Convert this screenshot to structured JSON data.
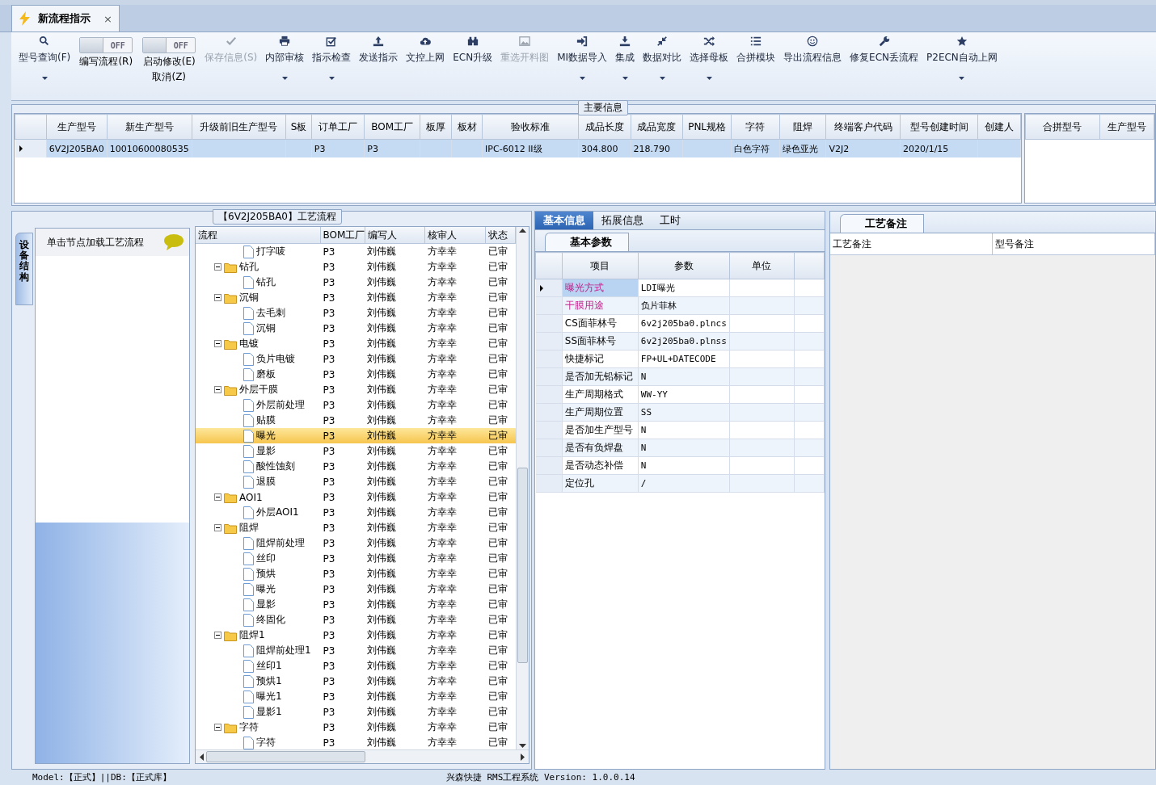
{
  "document_tab": {
    "title": "新流程指示",
    "close": "×"
  },
  "toolbar": [
    {
      "kind": "button",
      "label": "型号查询(F)",
      "dropdown": true,
      "disabled": false
    },
    {
      "kind": "toggle",
      "toggle_text": "OFF",
      "on": false,
      "label": "编写流程(R)"
    },
    {
      "kind": "toggle",
      "toggle_text": "OFF",
      "on": false,
      "label": "启动修改(E)",
      "label2": "取消(Z)"
    },
    {
      "kind": "button",
      "label": "保存信息(S)",
      "dropdown": false,
      "disabled": true
    },
    {
      "kind": "button",
      "label": "内部审核",
      "dropdown": true,
      "disabled": false
    },
    {
      "kind": "button",
      "label": "指示检查",
      "dropdown": true,
      "disabled": false
    },
    {
      "kind": "button",
      "label": "发送指示",
      "dropdown": false,
      "disabled": false
    },
    {
      "kind": "button",
      "label": "文控上网",
      "dropdown": false,
      "disabled": false
    },
    {
      "kind": "button",
      "label": "ECN升级",
      "dropdown": false,
      "disabled": false
    },
    {
      "kind": "button",
      "label": "重选开料图",
      "dropdown": false,
      "disabled": true
    },
    {
      "kind": "button",
      "label": "MI数据导入",
      "dropdown": true,
      "disabled": false
    },
    {
      "kind": "button",
      "label": "集成",
      "dropdown": true,
      "disabled": false
    },
    {
      "kind": "button",
      "label": "数据对比",
      "dropdown": true,
      "disabled": false
    },
    {
      "kind": "button",
      "label": "选择母板",
      "dropdown": true,
      "disabled": false
    },
    {
      "kind": "button",
      "label": "合拼模块",
      "dropdown": false,
      "disabled": false
    },
    {
      "kind": "button",
      "label": "导出流程信息",
      "dropdown": false,
      "disabled": false
    },
    {
      "kind": "button",
      "label": "修复ECN丢流程",
      "dropdown": false,
      "disabled": false
    },
    {
      "kind": "button",
      "label": "P2ECN自动上网",
      "dropdown": true,
      "disabled": false
    }
  ],
  "main_info": {
    "title": "主要信息",
    "columns": [
      "生产型号",
      "新生产型号",
      "升级前旧生产型号",
      "S板",
      "订单工厂",
      "BOM工厂",
      "板厚",
      "板材",
      "验收标准",
      "成品长度",
      "成品宽度",
      "PNL规格",
      "字符",
      "阻焊",
      "终端客户代码",
      "型号创建时间",
      "创建人"
    ],
    "rows": [
      {
        "selected": true,
        "cells": [
          "6V2J205BA0",
          "10010600080535",
          null,
          null,
          "P3",
          "P3",
          null,
          null,
          "IPC-6012 II级",
          "304.800",
          "218.790",
          null,
          "白色字符",
          "绿色亚光",
          "V2J2",
          "2020/1/15",
          null
        ]
      }
    ],
    "merge_columns": [
      "合拼型号",
      "生产型号"
    ]
  },
  "flow_panel": {
    "title": "【6V2J205BA0】工艺流程",
    "side_tab": "设备结构",
    "hint": "单击节点加载工艺流程",
    "columns": [
      "流程",
      "BOM工厂",
      "编写人",
      "核审人",
      "状态"
    ],
    "tree": [
      {
        "kind": "file",
        "label": "打字唛",
        "bom": "P3",
        "writer": "刘伟巍",
        "reviewer": "方幸幸",
        "status": "已审",
        "selected": false
      },
      {
        "kind": "folder",
        "label": "钻孔",
        "bom": "P3",
        "writer": "刘伟巍",
        "reviewer": "方幸幸",
        "status": "已审",
        "selected": false,
        "expanded": true,
        "children": [
          {
            "kind": "file",
            "label": "钻孔",
            "bom": "P3",
            "writer": "刘伟巍",
            "reviewer": "方幸幸",
            "status": "已审",
            "selected": false
          }
        ]
      },
      {
        "kind": "folder",
        "label": "沉铜",
        "bom": "P3",
        "writer": "刘伟巍",
        "reviewer": "方幸幸",
        "status": "已审",
        "selected": false,
        "expanded": true,
        "children": [
          {
            "kind": "file",
            "label": "去毛刺",
            "bom": "P3",
            "writer": "刘伟巍",
            "reviewer": "方幸幸",
            "status": "已审",
            "selected": false
          },
          {
            "kind": "file",
            "label": "沉铜",
            "bom": "P3",
            "writer": "刘伟巍",
            "reviewer": "方幸幸",
            "status": "已审",
            "selected": false
          }
        ]
      },
      {
        "kind": "folder",
        "label": "电镀",
        "bom": "P3",
        "writer": "刘伟巍",
        "reviewer": "方幸幸",
        "status": "已审",
        "selected": false,
        "expanded": true,
        "children": [
          {
            "kind": "file",
            "label": "负片电镀",
            "bom": "P3",
            "writer": "刘伟巍",
            "reviewer": "方幸幸",
            "status": "已审",
            "selected": false
          },
          {
            "kind": "file",
            "label": "磨板",
            "bom": "P3",
            "writer": "刘伟巍",
            "reviewer": "方幸幸",
            "status": "已审",
            "selected": false
          }
        ]
      },
      {
        "kind": "folder",
        "label": "外层干膜",
        "bom": "P3",
        "writer": "刘伟巍",
        "reviewer": "方幸幸",
        "status": "已审",
        "selected": false,
        "expanded": true,
        "children": [
          {
            "kind": "file",
            "label": "外层前处理",
            "bom": "P3",
            "writer": "刘伟巍",
            "reviewer": "方幸幸",
            "status": "已审",
            "selected": false
          },
          {
            "kind": "file",
            "label": "贴膜",
            "bom": "P3",
            "writer": "刘伟巍",
            "reviewer": "方幸幸",
            "status": "已审",
            "selected": false
          },
          {
            "kind": "file",
            "label": "曝光",
            "bom": "P3",
            "writer": "刘伟巍",
            "reviewer": "方幸幸",
            "status": "已审",
            "selected": true
          },
          {
            "kind": "file",
            "label": "显影",
            "bom": "P3",
            "writer": "刘伟巍",
            "reviewer": "方幸幸",
            "status": "已审",
            "selected": false
          },
          {
            "kind": "file",
            "label": "酸性蚀刻",
            "bom": "P3",
            "writer": "刘伟巍",
            "reviewer": "方幸幸",
            "status": "已审",
            "selected": false
          },
          {
            "kind": "file",
            "label": "退膜",
            "bom": "P3",
            "writer": "刘伟巍",
            "reviewer": "方幸幸",
            "status": "已审",
            "selected": false
          }
        ]
      },
      {
        "kind": "folder",
        "label": "AOI1",
        "bom": "P3",
        "writer": "刘伟巍",
        "reviewer": "方幸幸",
        "status": "已审",
        "selected": false,
        "expanded": true,
        "children": [
          {
            "kind": "file",
            "label": "外层AOI1",
            "bom": "P3",
            "writer": "刘伟巍",
            "reviewer": "方幸幸",
            "status": "已审",
            "selected": false
          }
        ]
      },
      {
        "kind": "folder",
        "label": "阻焊",
        "bom": "P3",
        "writer": "刘伟巍",
        "reviewer": "方幸幸",
        "status": "已审",
        "selected": false,
        "expanded": true,
        "children": [
          {
            "kind": "file",
            "label": "阻焊前处理",
            "bom": "P3",
            "writer": "刘伟巍",
            "reviewer": "方幸幸",
            "status": "已审",
            "selected": false
          },
          {
            "kind": "file",
            "label": "丝印",
            "bom": "P3",
            "writer": "刘伟巍",
            "reviewer": "方幸幸",
            "status": "已审",
            "selected": false
          },
          {
            "kind": "file",
            "label": "预烘",
            "bom": "P3",
            "writer": "刘伟巍",
            "reviewer": "方幸幸",
            "status": "已审",
            "selected": false
          },
          {
            "kind": "file",
            "label": "曝光",
            "bom": "P3",
            "writer": "刘伟巍",
            "reviewer": "方幸幸",
            "status": "已审",
            "selected": false
          },
          {
            "kind": "file",
            "label": "显影",
            "bom": "P3",
            "writer": "刘伟巍",
            "reviewer": "方幸幸",
            "status": "已审",
            "selected": false
          },
          {
            "kind": "file",
            "label": "终固化",
            "bom": "P3",
            "writer": "刘伟巍",
            "reviewer": "方幸幸",
            "status": "已审",
            "selected": false
          }
        ]
      },
      {
        "kind": "folder",
        "label": "阻焊1",
        "bom": "P3",
        "writer": "刘伟巍",
        "reviewer": "方幸幸",
        "status": "已审",
        "selected": false,
        "expanded": true,
        "children": [
          {
            "kind": "file",
            "label": "阻焊前处理1",
            "bom": "P3",
            "writer": "刘伟巍",
            "reviewer": "方幸幸",
            "status": "已审",
            "selected": false
          },
          {
            "kind": "file",
            "label": "丝印1",
            "bom": "P3",
            "writer": "刘伟巍",
            "reviewer": "方幸幸",
            "status": "已审",
            "selected": false
          },
          {
            "kind": "file",
            "label": "预烘1",
            "bom": "P3",
            "writer": "刘伟巍",
            "reviewer": "方幸幸",
            "status": "已审",
            "selected": false
          },
          {
            "kind": "file",
            "label": "曝光1",
            "bom": "P3",
            "writer": "刘伟巍",
            "reviewer": "方幸幸",
            "status": "已审",
            "selected": false
          },
          {
            "kind": "file",
            "label": "显影1",
            "bom": "P3",
            "writer": "刘伟巍",
            "reviewer": "方幸幸",
            "status": "已审",
            "selected": false
          }
        ]
      },
      {
        "kind": "folder",
        "label": "字符",
        "bom": "P3",
        "writer": "刘伟巍",
        "reviewer": "方幸幸",
        "status": "已审",
        "selected": false,
        "expanded": true,
        "children": [
          {
            "kind": "file",
            "label": "字符",
            "bom": "P3",
            "writer": "刘伟巍",
            "reviewer": "方幸幸",
            "status": "已审",
            "selected": false
          }
        ]
      }
    ]
  },
  "detail_tabs": [
    {
      "label": "基本信息",
      "selected": true
    },
    {
      "label": "拓展信息",
      "selected": false
    },
    {
      "label": "工时",
      "selected": false
    }
  ],
  "params": {
    "tab": "基本参数",
    "columns": [
      "项目",
      "参数",
      "单位"
    ],
    "rows": [
      {
        "item": "曝光方式",
        "value": "LDI曝光",
        "selected": true,
        "highlighted": true
      },
      {
        "item": "干膜用途",
        "value": "负片菲林",
        "selected": false,
        "highlighted": true
      },
      {
        "item": "CS面菲林号",
        "value": "6v2j205ba0.plncs",
        "selected": false,
        "highlighted": false
      },
      {
        "item": "SS面菲林号",
        "value": "6v2j205ba0.plnss",
        "selected": false,
        "highlighted": false
      },
      {
        "item": "快捷标记",
        "value": "FP+UL+DATECODE",
        "selected": false,
        "highlighted": false
      },
      {
        "item": "是否加无铅标记",
        "value": "N",
        "selected": false,
        "highlighted": false
      },
      {
        "item": "生产周期格式",
        "value": "WW-YY",
        "selected": false,
        "highlighted": false
      },
      {
        "item": "生产周期位置",
        "value": "SS",
        "selected": false,
        "highlighted": false
      },
      {
        "item": "是否加生产型号",
        "value": "N",
        "selected": false,
        "highlighted": false
      },
      {
        "item": "是否有负焊盘",
        "value": "N",
        "selected": false,
        "highlighted": false
      },
      {
        "item": "是否动态补偿",
        "value": "N",
        "selected": false,
        "highlighted": false
      },
      {
        "item": "定位孔",
        "value": "/",
        "selected": false,
        "highlighted": false
      }
    ]
  },
  "notes": {
    "tab": "工艺备注",
    "columns": [
      "工艺备注",
      "型号备注"
    ]
  },
  "status_bar": {
    "left": "Model:【正式】||DB:【正式库】",
    "center": "兴森快捷 RMS工程系统 Version: 1.0.0.14"
  }
}
